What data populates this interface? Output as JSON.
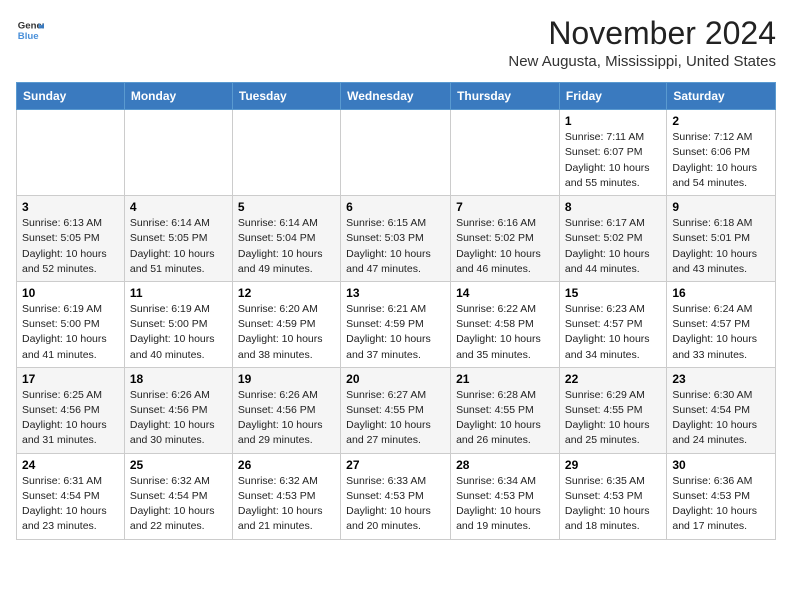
{
  "logo": {
    "general": "General",
    "blue": "Blue"
  },
  "header": {
    "month": "November 2024",
    "location": "New Augusta, Mississippi, United States"
  },
  "weekdays": [
    "Sunday",
    "Monday",
    "Tuesday",
    "Wednesday",
    "Thursday",
    "Friday",
    "Saturday"
  ],
  "weeks": [
    [
      {
        "day": "",
        "info": ""
      },
      {
        "day": "",
        "info": ""
      },
      {
        "day": "",
        "info": ""
      },
      {
        "day": "",
        "info": ""
      },
      {
        "day": "",
        "info": ""
      },
      {
        "day": "1",
        "info": "Sunrise: 7:11 AM\nSunset: 6:07 PM\nDaylight: 10 hours\nand 55 minutes."
      },
      {
        "day": "2",
        "info": "Sunrise: 7:12 AM\nSunset: 6:06 PM\nDaylight: 10 hours\nand 54 minutes."
      }
    ],
    [
      {
        "day": "3",
        "info": "Sunrise: 6:13 AM\nSunset: 5:05 PM\nDaylight: 10 hours\nand 52 minutes."
      },
      {
        "day": "4",
        "info": "Sunrise: 6:14 AM\nSunset: 5:05 PM\nDaylight: 10 hours\nand 51 minutes."
      },
      {
        "day": "5",
        "info": "Sunrise: 6:14 AM\nSunset: 5:04 PM\nDaylight: 10 hours\nand 49 minutes."
      },
      {
        "day": "6",
        "info": "Sunrise: 6:15 AM\nSunset: 5:03 PM\nDaylight: 10 hours\nand 47 minutes."
      },
      {
        "day": "7",
        "info": "Sunrise: 6:16 AM\nSunset: 5:02 PM\nDaylight: 10 hours\nand 46 minutes."
      },
      {
        "day": "8",
        "info": "Sunrise: 6:17 AM\nSunset: 5:02 PM\nDaylight: 10 hours\nand 44 minutes."
      },
      {
        "day": "9",
        "info": "Sunrise: 6:18 AM\nSunset: 5:01 PM\nDaylight: 10 hours\nand 43 minutes."
      }
    ],
    [
      {
        "day": "10",
        "info": "Sunrise: 6:19 AM\nSunset: 5:00 PM\nDaylight: 10 hours\nand 41 minutes."
      },
      {
        "day": "11",
        "info": "Sunrise: 6:19 AM\nSunset: 5:00 PM\nDaylight: 10 hours\nand 40 minutes."
      },
      {
        "day": "12",
        "info": "Sunrise: 6:20 AM\nSunset: 4:59 PM\nDaylight: 10 hours\nand 38 minutes."
      },
      {
        "day": "13",
        "info": "Sunrise: 6:21 AM\nSunset: 4:59 PM\nDaylight: 10 hours\nand 37 minutes."
      },
      {
        "day": "14",
        "info": "Sunrise: 6:22 AM\nSunset: 4:58 PM\nDaylight: 10 hours\nand 35 minutes."
      },
      {
        "day": "15",
        "info": "Sunrise: 6:23 AM\nSunset: 4:57 PM\nDaylight: 10 hours\nand 34 minutes."
      },
      {
        "day": "16",
        "info": "Sunrise: 6:24 AM\nSunset: 4:57 PM\nDaylight: 10 hours\nand 33 minutes."
      }
    ],
    [
      {
        "day": "17",
        "info": "Sunrise: 6:25 AM\nSunset: 4:56 PM\nDaylight: 10 hours\nand 31 minutes."
      },
      {
        "day": "18",
        "info": "Sunrise: 6:26 AM\nSunset: 4:56 PM\nDaylight: 10 hours\nand 30 minutes."
      },
      {
        "day": "19",
        "info": "Sunrise: 6:26 AM\nSunset: 4:56 PM\nDaylight: 10 hours\nand 29 minutes."
      },
      {
        "day": "20",
        "info": "Sunrise: 6:27 AM\nSunset: 4:55 PM\nDaylight: 10 hours\nand 27 minutes."
      },
      {
        "day": "21",
        "info": "Sunrise: 6:28 AM\nSunset: 4:55 PM\nDaylight: 10 hours\nand 26 minutes."
      },
      {
        "day": "22",
        "info": "Sunrise: 6:29 AM\nSunset: 4:55 PM\nDaylight: 10 hours\nand 25 minutes."
      },
      {
        "day": "23",
        "info": "Sunrise: 6:30 AM\nSunset: 4:54 PM\nDaylight: 10 hours\nand 24 minutes."
      }
    ],
    [
      {
        "day": "24",
        "info": "Sunrise: 6:31 AM\nSunset: 4:54 PM\nDaylight: 10 hours\nand 23 minutes."
      },
      {
        "day": "25",
        "info": "Sunrise: 6:32 AM\nSunset: 4:54 PM\nDaylight: 10 hours\nand 22 minutes."
      },
      {
        "day": "26",
        "info": "Sunrise: 6:32 AM\nSunset: 4:53 PM\nDaylight: 10 hours\nand 21 minutes."
      },
      {
        "day": "27",
        "info": "Sunrise: 6:33 AM\nSunset: 4:53 PM\nDaylight: 10 hours\nand 20 minutes."
      },
      {
        "day": "28",
        "info": "Sunrise: 6:34 AM\nSunset: 4:53 PM\nDaylight: 10 hours\nand 19 minutes."
      },
      {
        "day": "29",
        "info": "Sunrise: 6:35 AM\nSunset: 4:53 PM\nDaylight: 10 hours\nand 18 minutes."
      },
      {
        "day": "30",
        "info": "Sunrise: 6:36 AM\nSunset: 4:53 PM\nDaylight: 10 hours\nand 17 minutes."
      }
    ]
  ]
}
